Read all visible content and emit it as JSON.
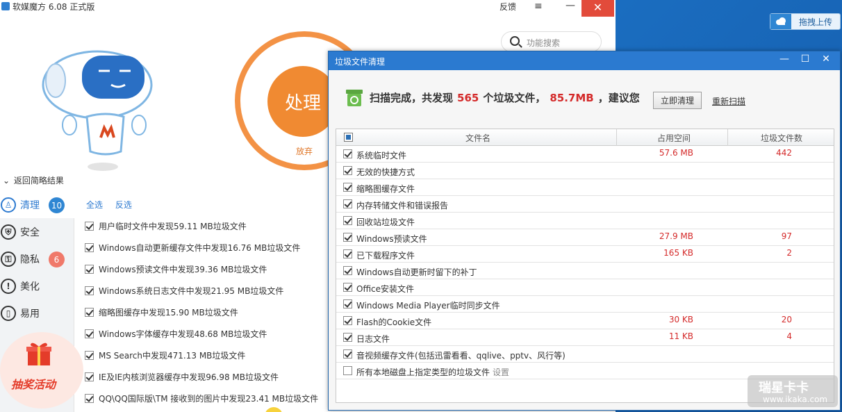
{
  "desktop": {
    "upload_widget": {
      "label": "拖拽上传",
      "icon": "cloud-icon"
    }
  },
  "app": {
    "title": "软媒魔方 6.08 正式版",
    "feedback": "反馈",
    "menu_glyph": "≡",
    "min_glyph": "—",
    "close_glyph": "✕",
    "search_placeholder": "功能搜索",
    "process_label": "处理",
    "abandon_label": "放弃",
    "back_link": "返回简略结果",
    "sidebar": [
      {
        "label": "清理",
        "icon": "broom-icon",
        "glyph": "♙",
        "badge": "10",
        "active": true
      },
      {
        "label": "安全",
        "icon": "shield-icon",
        "glyph": "⛨",
        "badge": "",
        "active": false
      },
      {
        "label": "隐私",
        "icon": "lock-icon",
        "glyph": "⚿",
        "badge": "6",
        "active": false
      },
      {
        "label": "美化",
        "icon": "exclamation-icon",
        "glyph": "!",
        "badge": "",
        "active": false
      },
      {
        "label": "易用",
        "icon": "bottle-icon",
        "glyph": "▯",
        "badge": "",
        "active": false
      }
    ],
    "lottery_label": "抽奖活动",
    "select_all": "全选",
    "invert_select": "反选",
    "results": [
      "用户临时文件中发现59.11 MB垃圾文件",
      "Windows自动更新缓存文件中发现16.76 MB垃圾文件",
      "Windows预读文件中发现39.36 MB垃圾文件",
      "Windows系统日志文件中发现21.95 MB垃圾文件",
      "缩略图缓存中发现15.90 MB垃圾文件",
      "Windows字体缓存中发现48.68 MB垃圾文件",
      "MS Search中发现471.13 MB垃圾文件",
      "IE及IE内核浏览器缓存中发现96.98 MB垃圾文件",
      "QQ\\QQ国际版\\TM 接收到的图片中发现23.41 MB垃圾文件"
    ]
  },
  "dialog": {
    "title": "垃圾文件清理",
    "min_glyph": "—",
    "max_glyph": "☐",
    "close_glyph": "✕",
    "summary_prefix": "扫描完成，共发现",
    "file_count": "565",
    "summary_mid": "个垃圾文件，",
    "total_size": "85.7MB",
    "summary_suffix": "，建议您",
    "clean_button": "立即清理",
    "rescan_link": "重新扫描",
    "columns": {
      "name": "文件名",
      "size": "占用空间",
      "count": "垃圾文件数"
    },
    "rows": [
      {
        "name": "系统临时文件",
        "size": "57.6 MB",
        "count": "442",
        "checked": true
      },
      {
        "name": "无效的快捷方式",
        "size": "",
        "count": "",
        "checked": true
      },
      {
        "name": "缩略图缓存文件",
        "size": "",
        "count": "",
        "checked": true
      },
      {
        "name": "内存转储文件和错误报告",
        "size": "",
        "count": "",
        "checked": true
      },
      {
        "name": "回收站垃圾文件",
        "size": "",
        "count": "",
        "checked": true
      },
      {
        "name": "Windows预读文件",
        "size": "27.9 MB",
        "count": "97",
        "checked": true
      },
      {
        "name": "已下载程序文件",
        "size": "165 KB",
        "count": "2",
        "checked": true
      },
      {
        "name": "Windows自动更新时留下的补丁",
        "size": "",
        "count": "",
        "checked": true
      },
      {
        "name": "Office安装文件",
        "size": "",
        "count": "",
        "checked": true
      },
      {
        "name": "Windows Media Player临时同步文件",
        "size": "",
        "count": "",
        "checked": true
      },
      {
        "name": "Flash的Cookie文件",
        "size": "30 KB",
        "count": "20",
        "checked": true
      },
      {
        "name": "日志文件",
        "size": "11 KB",
        "count": "4",
        "checked": true
      },
      {
        "name": "音视频缓存文件(包括迅雷看看、qqlive、pptv、风行等)",
        "size": "",
        "count": "",
        "checked": true
      },
      {
        "name": "所有本地磁盘上指定类型的垃圾文件",
        "size": "",
        "count": "",
        "checked": false,
        "extra": "设置"
      }
    ]
  },
  "watermark": {
    "big": "瑞星卡卡",
    "small": "www.ikaka.com"
  },
  "colors": {
    "accent_blue": "#2b7ad0",
    "orange": "#f08a32",
    "alert_red": "#d42a2a",
    "close_red": "#e24b3b"
  }
}
